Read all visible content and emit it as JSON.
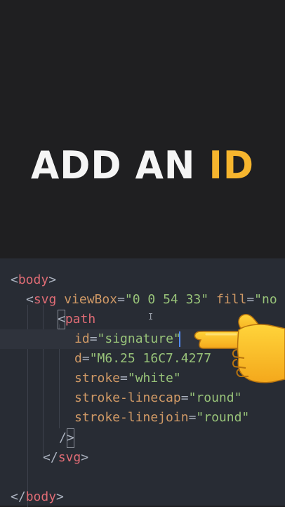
{
  "title": {
    "main": "ADD AN ",
    "accent": "ID",
    "accent_color": "#f6b52e"
  },
  "code": {
    "l1": {
      "open": "<",
      "tag": "body",
      "close": ">"
    },
    "l2": {
      "open": "<",
      "tag": "svg",
      "attr1": "viewBox",
      "eq1": "=",
      "val1": "\"0 0 54 33\"",
      "attr2": "fill",
      "eq2": "=",
      "val2": "\"no"
    },
    "l3": {
      "open": "<",
      "tag": "path"
    },
    "l4": {
      "attr": "id",
      "eq": "=",
      "val": "\"signature\""
    },
    "l5": {
      "attr": "d",
      "eq": "=",
      "val": "\"M6.25 16C7.4277"
    },
    "l6": {
      "attr": "stroke",
      "eq": "=",
      "val": "\"white\""
    },
    "l7": {
      "attr": "stroke-linecap",
      "eq": "=",
      "val": "\"round\""
    },
    "l8": {
      "attr": "stroke-linejoin",
      "eq": "=",
      "val": "\"round\""
    },
    "l9": {
      "slash": "/",
      "close": ">"
    },
    "l10": {
      "open": "</",
      "tag": "svg",
      "close": ">"
    },
    "l12": {
      "open": "</",
      "tag": "body",
      "close": ">"
    }
  },
  "icons": {
    "pointer": "pointing-hand-icon",
    "cursor": "text-ibeam-icon"
  }
}
